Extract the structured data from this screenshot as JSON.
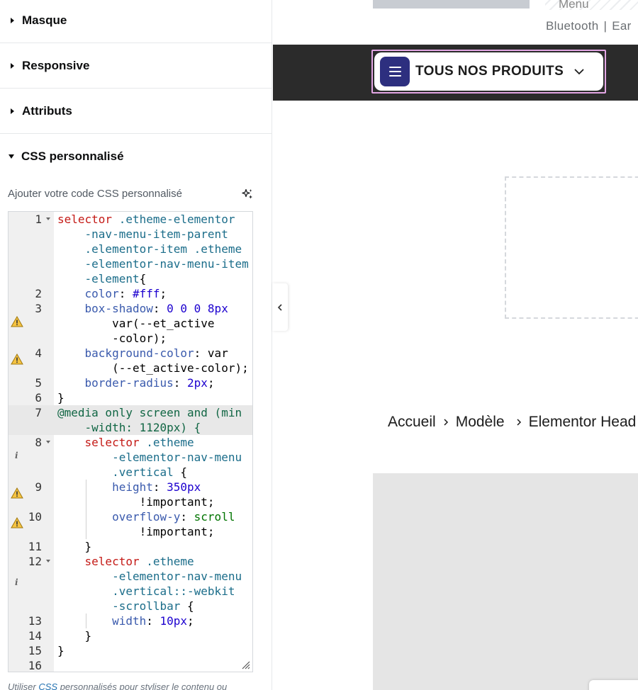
{
  "panel": {
    "sections": [
      {
        "title": "Masque"
      },
      {
        "title": "Responsive"
      },
      {
        "title": "Attributs"
      },
      {
        "title": "CSS personnalisé"
      }
    ],
    "css_label": "Ajouter votre code CSS personnalisé",
    "help_prefix": "Utiliser ",
    "help_link": "CSS",
    "help_suffix": " personnalisés pour styliser le contenu ou"
  },
  "editor": {
    "line_numbers": [
      "1",
      "2",
      "3",
      "4",
      "5",
      "6",
      "7",
      "8",
      "9",
      "10",
      "11",
      "12",
      "13",
      "14",
      "15",
      "16"
    ],
    "active_line": "7"
  },
  "preview": {
    "top_menu": "Menu",
    "top_links": [
      "Bluetooth",
      "Ear"
    ],
    "nav_button": "TOUS NOS PRODUITS",
    "breadcrumb": [
      "Accueil",
      "Modèle",
      "Elementor Head"
    ],
    "colors": {
      "navbar": "#2b2b2b",
      "hamburger_bg": "#2d2f7f",
      "outline": "#e3a6e4"
    }
  }
}
